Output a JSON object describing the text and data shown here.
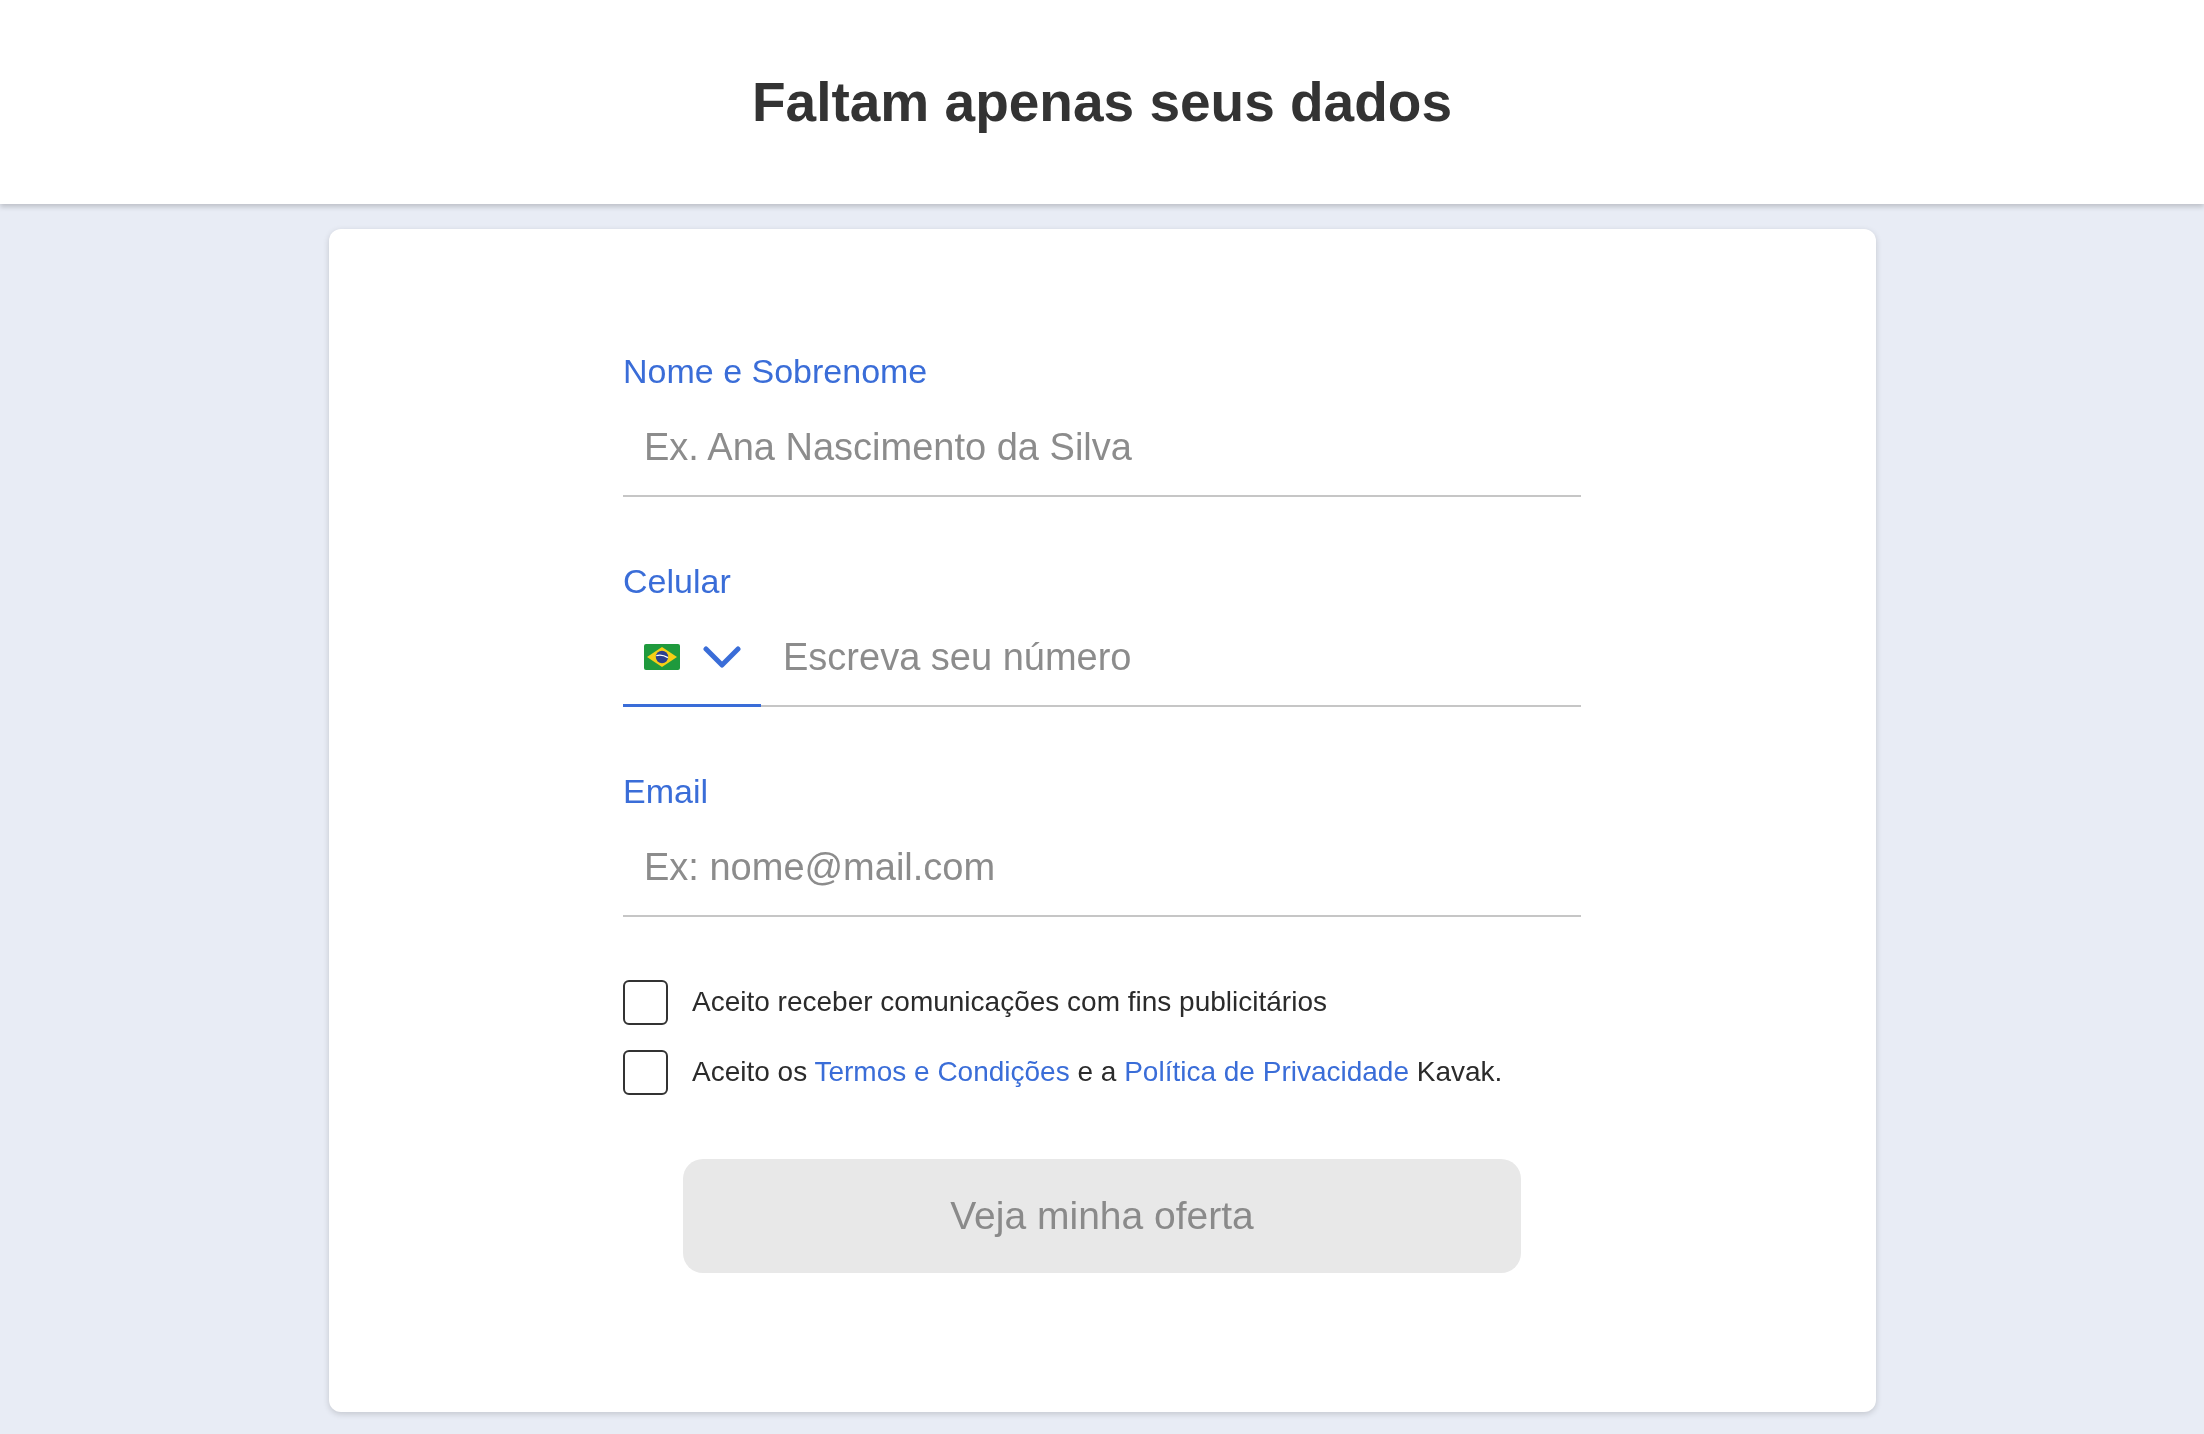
{
  "header": {
    "title": "Faltam apenas seus dados"
  },
  "form": {
    "fields": [
      {
        "kind": "text",
        "label": "Nome e Sobrenome",
        "placeholder": "Ex. Ana Nascimento da Silva"
      },
      {
        "kind": "phone",
        "label": "Celular",
        "placeholder": "Escreva seu número",
        "selector_focused": true
      },
      {
        "kind": "email",
        "label": "Email",
        "placeholder": "Ex: nome@mail.com"
      }
    ],
    "consents": [
      {
        "checked": false,
        "parts": [
          {
            "kind": "text",
            "text": "Aceito receber comunicações com fins publicitários"
          }
        ]
      },
      {
        "checked": false,
        "parts": [
          {
            "kind": "text",
            "text": "Aceito os"
          },
          {
            "kind": "link",
            "text": "Termos e Condições"
          },
          {
            "kind": "text",
            "text": "e a"
          },
          {
            "kind": "link",
            "text": "Política de Privacidade"
          },
          {
            "kind": "text",
            "text": "Kavak."
          }
        ]
      }
    ],
    "submit": {
      "label": "Veja minha oferta",
      "disabled": true
    }
  }
}
